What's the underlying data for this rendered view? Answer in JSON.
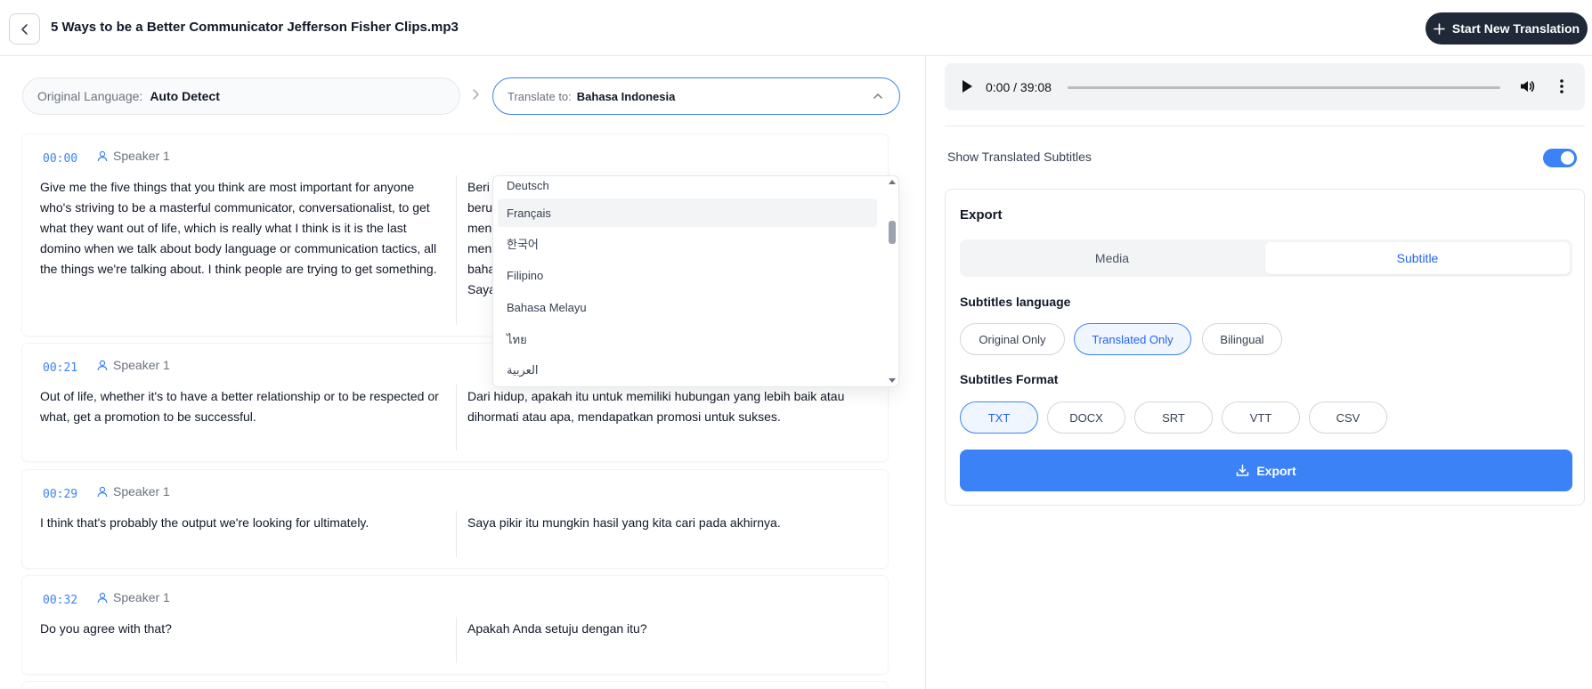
{
  "header": {
    "file_title": "5 Ways to be a Better Communicator Jefferson Fisher Clips.mp3",
    "new_translation_label": "Start New Translation"
  },
  "languages": {
    "original_label": "Original Language:",
    "original_value": "Auto Detect",
    "translate_label": "Translate to:",
    "translate_value": "Bahasa Indonesia"
  },
  "dropdown": {
    "options": [
      "Deutsch",
      "Français",
      "한국어",
      "Filipino",
      "Bahasa Melayu",
      "ไทย",
      "العربية"
    ],
    "highlighted": "Français"
  },
  "segments": [
    {
      "time": "00:00",
      "speaker": "Speaker 1",
      "original": "Give me the five things that you think are most important for anyone who's striving to be a masterful communicator, conversationalist, to get what they want out of life, which is really what I think is it is the last domino when we talk about body language or communication tactics, all the things we're talking about. I think people are trying to get something.",
      "translated_lines": [
        "Beri",
        "beru",
        "men",
        "men",
        "baha",
        "Saya"
      ]
    },
    {
      "time": "00:21",
      "speaker": "Speaker 1",
      "original": "Out of life, whether it's to have a better relationship or to be respected or what, get a promotion to be successful.",
      "translated": "Dari hidup, apakah itu untuk memiliki hubungan yang lebih baik atau dihormati atau apa, mendapatkan promosi untuk sukses."
    },
    {
      "time": "00:29",
      "speaker": "Speaker 1",
      "original": "I think that's probably the output we're looking for ultimately.",
      "translated": "Saya pikir itu mungkin hasil yang kita cari pada akhirnya."
    },
    {
      "time": "00:32",
      "speaker": "Speaker 1",
      "original": "Do you agree with that?",
      "translated": "Apakah Anda setuju dengan itu?"
    }
  ],
  "player": {
    "time": "0:00 / 39:08"
  },
  "subtitles_toggle": {
    "label": "Show Translated Subtitles",
    "on": true
  },
  "export": {
    "title": "Export",
    "tabs": [
      "Media",
      "Subtitle"
    ],
    "active_tab": "Subtitle",
    "subtitles_language_title": "Subtitles language",
    "language_options": [
      "Original Only",
      "Translated Only",
      "Bilingual"
    ],
    "selected_language": "Translated Only",
    "format_title": "Subtitles Format",
    "formats": [
      "TXT",
      "DOCX",
      "SRT",
      "VTT",
      "CSV"
    ],
    "selected_format": "TXT",
    "button_label": "Export"
  },
  "colors": {
    "accent": "#3b82f6",
    "dark": "#1f2937"
  }
}
